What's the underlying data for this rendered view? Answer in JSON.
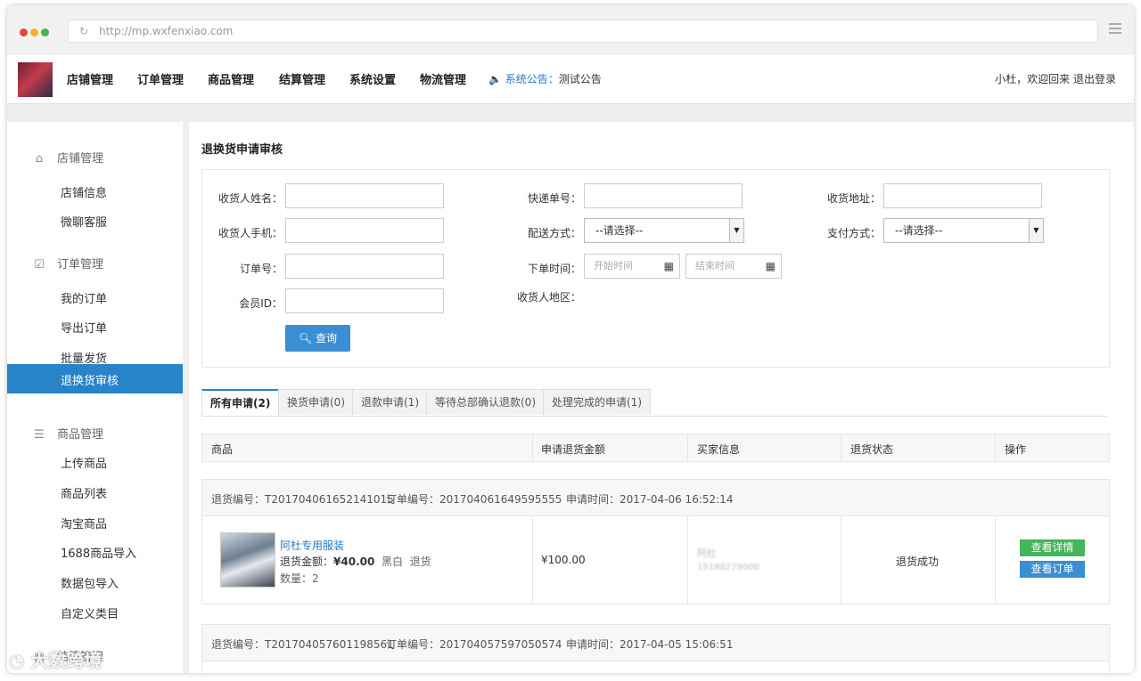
{
  "browser": {
    "url": "http://mp.wxfenxiao.com",
    "dot_colors": [
      "#e2463b",
      "#f0b429",
      "#43b649"
    ]
  },
  "topnav": {
    "items": [
      "店铺管理",
      "订单管理",
      "商品管理",
      "结算管理",
      "系统设置",
      "物流管理"
    ],
    "notice_label": "系统公告：",
    "notice_text": "测试公告",
    "user_text": "小杜，欢迎回来",
    "logout": "退出登录"
  },
  "sidebar": {
    "groups": [
      {
        "label": "店铺管理",
        "icon": "home-icon",
        "items": [
          "店铺信息",
          "微聊客服"
        ]
      },
      {
        "label": "订单管理",
        "icon": "clipboard-check-icon",
        "items": [
          "我的订单",
          "导出订单",
          "批量发货",
          "退换货审核"
        ]
      },
      {
        "label": "商品管理",
        "icon": "database-icon",
        "items": [
          "上传商品",
          "商品列表",
          "淘宝商品",
          "1688商品导入",
          "数据包导入",
          "自定义类目"
        ]
      },
      {
        "label": "结算管理",
        "icon": "wallet-icon",
        "items": []
      }
    ],
    "active_item": "退换货审核"
  },
  "main": {
    "title": "退换货申请审核",
    "filters": {
      "receiver_name": "收货人姓名：",
      "express_no": "快递单号：",
      "receiver_address": "收货地址：",
      "receiver_phone": "收货人手机：",
      "delivery_method": "配送方式：",
      "delivery_value": "--请选择--",
      "pay_method": "支付方式：",
      "pay_value": "--请选择--",
      "order_no": "订单号：",
      "order_time": "下单时间：",
      "start_placeholder": "开始时间",
      "end_placeholder": "结束时间",
      "member_id": "会员ID：",
      "receiver_region": "收货人地区：",
      "search_button": "查询"
    },
    "tabs": [
      "所有申请(2)",
      "换货申请(0)",
      "退款申请(1)",
      "等待总部确认退款(0)",
      "处理完成的申请(1)"
    ],
    "active_tab": 0,
    "table_headers": [
      "商品",
      "申请退货金额",
      "买家信息",
      "退货状态",
      "操作"
    ],
    "records": [
      {
        "return_no": "退货编号：T201704061652141015",
        "order_no": "订单编号：201704061649595555",
        "apply_time": "申请时间：2017-04-06 16:52:14",
        "product_name": "阿杜专用服装",
        "refund_label": "退货金额：",
        "refund_amount": "¥40.00",
        "variant": "黑白",
        "type": "退货",
        "qty": "数量：2",
        "amount": "¥100.00",
        "buyer_name": "阿杜",
        "buyer_phone": "15188279000",
        "status": "退货成功",
        "btn_detail": "查看详情",
        "btn_order": "查看订单"
      },
      {
        "return_no": "退货编号：T201704057601198561",
        "order_no": "订单编号：201704057597050574",
        "apply_time": "申请时间：2017-04-05 15:06:51"
      }
    ]
  },
  "watermark": "大数跨境"
}
